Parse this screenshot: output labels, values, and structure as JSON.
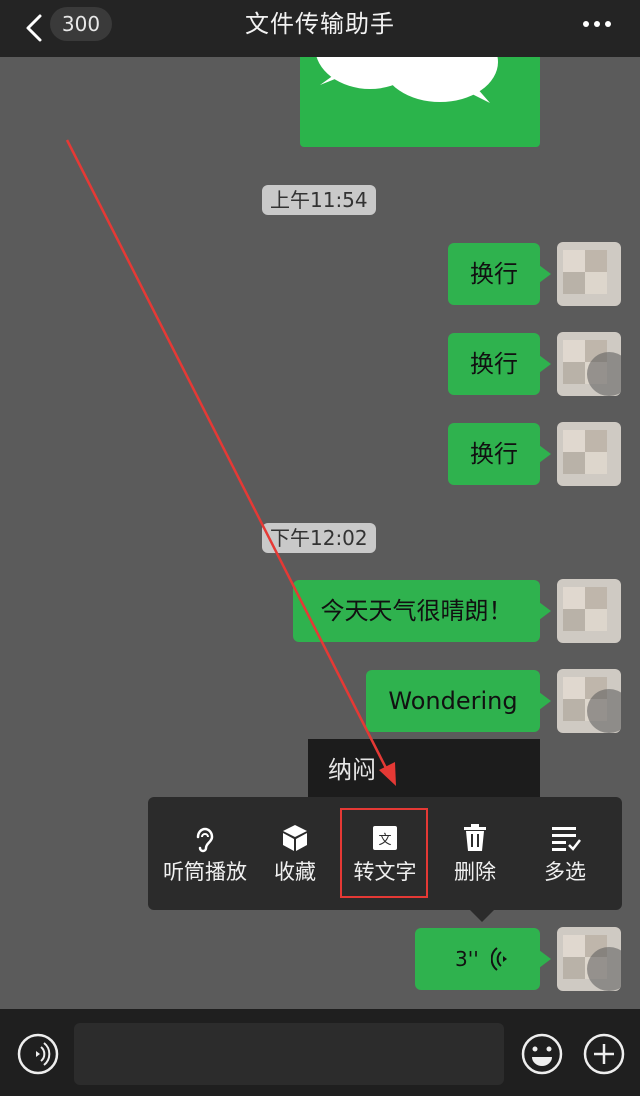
{
  "header": {
    "back_count": "300",
    "title": "文件传输助手"
  },
  "messages": {
    "time1": "上午11:54",
    "msg1": "换行",
    "msg2": "换行",
    "msg3": "换行",
    "time2": "下午12:02",
    "msg4": "今天天气很晴朗！",
    "msg5": "Wondering",
    "tooltip": "纳闷",
    "voice_duration": "3''"
  },
  "context_menu": {
    "items": [
      {
        "label": "听筒播放",
        "icon": "ear-icon"
      },
      {
        "label": "收藏",
        "icon": "cube-icon"
      },
      {
        "label": "转文字",
        "icon": "text-convert-icon"
      },
      {
        "label": "删除",
        "icon": "trash-icon"
      },
      {
        "label": "多选",
        "icon": "multi-select-icon"
      }
    ]
  },
  "colors": {
    "bubble": "#2fb24e",
    "background": "#5b5b5b",
    "bar": "#242424",
    "highlight": "#e53935"
  }
}
